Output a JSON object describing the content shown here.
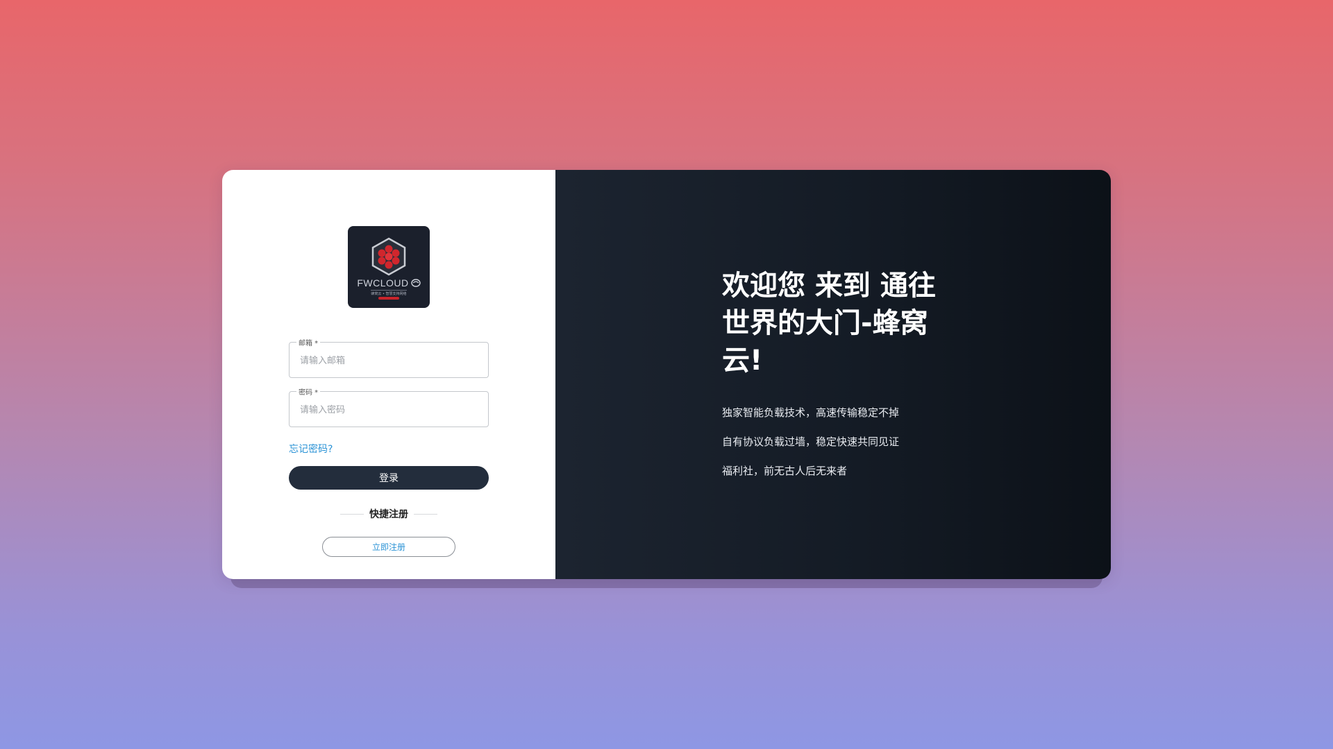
{
  "logo": {
    "brand_text": "FWCLOUD",
    "tagline": "蜂窝云 • 智慧支持网络",
    "icon": "hexagon-cluster-logo-icon"
  },
  "form": {
    "email": {
      "label": "邮箱 *",
      "placeholder": "请输入邮箱",
      "value": ""
    },
    "password": {
      "label": "密码 *",
      "placeholder": "请输入密码",
      "value": ""
    },
    "forgot_label": "忘记密码?",
    "login_label": "登录",
    "quick_register_label": "快捷注册",
    "register_label": "立即注册"
  },
  "promo": {
    "headline": "欢迎您 来到 通往世界的大门-蜂窝云!",
    "features": [
      "独家智能负载技术，高速传输稳定不掉",
      "自有协议负载过墙，稳定快速共同见证",
      "福利社，前无古人后无来者"
    ]
  },
  "colors": {
    "button_dark": "#232d3c",
    "link_blue": "#2b93d6",
    "panel_dark": "#141b25",
    "logo_red": "#c8242b"
  }
}
